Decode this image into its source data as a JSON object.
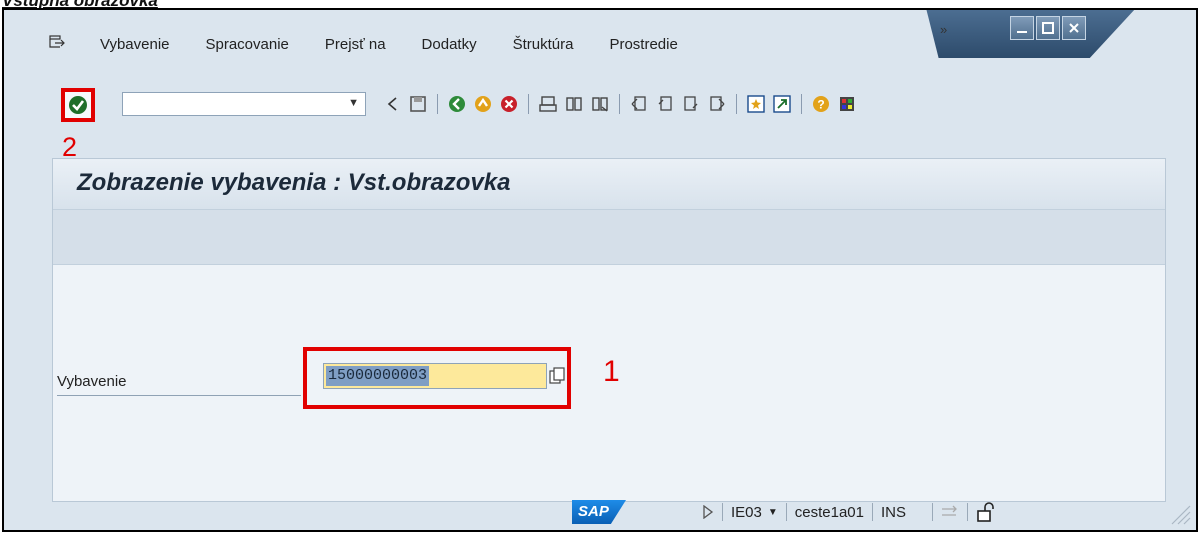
{
  "document": {
    "caption": "Vstupná obrazovka"
  },
  "window": {
    "controls": [
      "minimize",
      "maximize",
      "close"
    ],
    "overflow": "»"
  },
  "menu": {
    "items": [
      "Vybavenie",
      "Spracovanie",
      "Prejsť na",
      "Dodatky",
      "Štruktúra",
      "Prostredie"
    ]
  },
  "toolbar": {
    "command_field_value": "",
    "icons": [
      "enter-icon",
      "back-small-icon",
      "save-icon",
      "back-icon",
      "exit-icon",
      "cancel-icon",
      "print-icon",
      "find-icon",
      "find-next-icon",
      "first-page-icon",
      "previous-page-icon",
      "next-page-icon",
      "last-page-icon",
      "new-session-icon",
      "shortcut-icon",
      "help-icon",
      "customize-layout-icon"
    ]
  },
  "annotations": {
    "step1": "1",
    "step2": "2",
    "highlight_color": "#e10000"
  },
  "screen": {
    "title": "Zobrazenie vybavenia : Vst.obrazovka",
    "field_label": "Vybavenie",
    "field_value": "15000000003"
  },
  "statusbar": {
    "logo": "SAP",
    "transaction": "IE03",
    "server": "ceste1a01",
    "mode": "INS"
  },
  "colors": {
    "window_bg": "#dbe5ee",
    "input_highlight": "#fde99b",
    "selection": "#7f9ec4"
  }
}
